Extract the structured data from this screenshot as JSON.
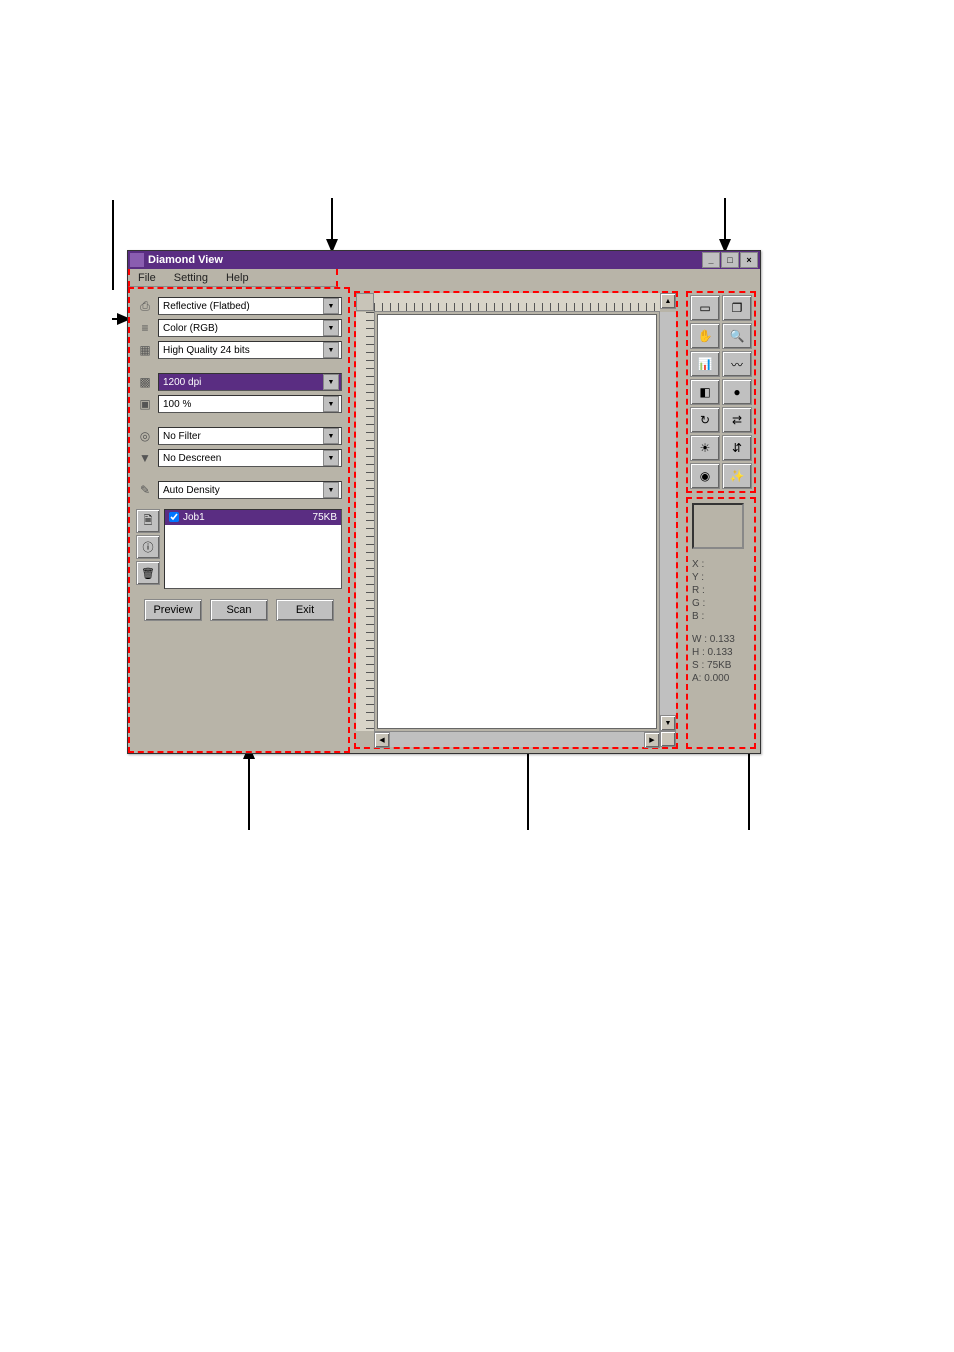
{
  "window": {
    "title": "Diamond View"
  },
  "menu": {
    "file": "File",
    "setting": "Setting",
    "help": "Help"
  },
  "settings": {
    "source": "Reflective (Flatbed)",
    "colormode": "Color (RGB)",
    "quality": "High Quality 24 bits",
    "resolution": "1200 dpi",
    "scale": "100 %",
    "filter": "No Filter",
    "descreen": "No Descreen",
    "density": "Auto Density"
  },
  "jobs": [
    {
      "name": "Job1",
      "size": "75KB",
      "checked": true
    }
  ],
  "buttons": {
    "preview": "Preview",
    "scan": "Scan",
    "exit": "Exit"
  },
  "info": {
    "x_label": "X :",
    "y_label": "Y :",
    "r_label": "R :",
    "g_label": "G :",
    "b_label": "B :",
    "w": "W : 0.133",
    "h": "H : 0.133",
    "s": "S : 75KB",
    "a": "A: 0.000"
  }
}
